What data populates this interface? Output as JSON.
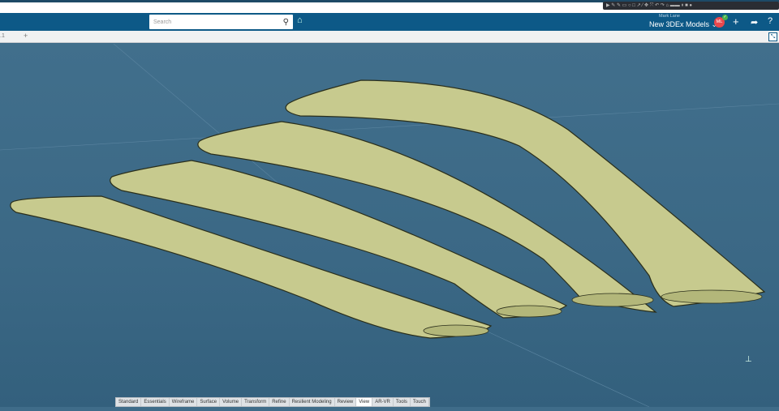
{
  "header": {
    "search_placeholder": "Search",
    "user_name": "Mark Lane",
    "space": "New 3DEx Models",
    "avatar_initials": "ML"
  },
  "tabs": {
    "current": ".1",
    "add": "+"
  },
  "action_bar": [
    "Standard",
    "Essentials",
    "Wireframe",
    "Surface",
    "Volume",
    "Transform",
    "Refine",
    "Resilient Modeling",
    "Review",
    "View",
    "AR-VR",
    "Tools",
    "Touch"
  ],
  "active_tab": "View",
  "colors": {
    "header": "#0d5987",
    "viewport": "#3f6c89",
    "blade": "#c7ca8e"
  }
}
